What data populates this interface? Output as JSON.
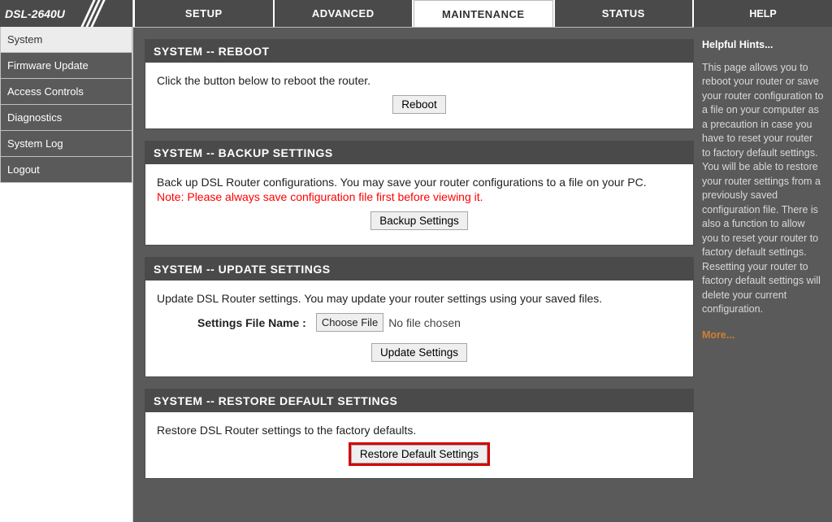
{
  "brand": "DSL-2640U",
  "tabs": {
    "setup": "SETUP",
    "advanced": "ADVANCED",
    "maintenance": "MAINTENANCE",
    "status": "STATUS",
    "help": "HELP"
  },
  "sidebar": {
    "system": "System",
    "firmware": "Firmware Update",
    "access": "Access Controls",
    "diagnostics": "Diagnostics",
    "syslog": "System Log",
    "logout": "Logout"
  },
  "reboot": {
    "title": "SYSTEM -- REBOOT",
    "text": "Click the button below to reboot the router.",
    "button": "Reboot"
  },
  "backup": {
    "title": "SYSTEM -- BACKUP SETTINGS",
    "text": "Back up DSL Router configurations. You may save your router configurations to a file on your PC.",
    "note": "Note: Please always save configuration file first before viewing it.",
    "button": "Backup Settings"
  },
  "update": {
    "title": "SYSTEM -- UPDATE SETTINGS",
    "text": "Update DSL Router settings. You may update your router settings using your saved files.",
    "file_label": "Settings File Name :",
    "choose": "Choose File",
    "no_file": "No file chosen",
    "button": "Update Settings"
  },
  "restore": {
    "title": "SYSTEM -- RESTORE DEFAULT SETTINGS",
    "text": "Restore DSL Router settings to the factory defaults.",
    "button": "Restore Default Settings"
  },
  "help": {
    "title": "Helpful Hints...",
    "body": "This page allows you to reboot your router or save your router configuration to a file on your computer as a precaution in case you have to reset your router to factory default settings. You will be able to restore your router settings from a previously saved configuration file. There is also a function to allow you to reset your router to factory default settings. Resetting your router to factory default settings will delete your current configuration.",
    "more": "More..."
  }
}
